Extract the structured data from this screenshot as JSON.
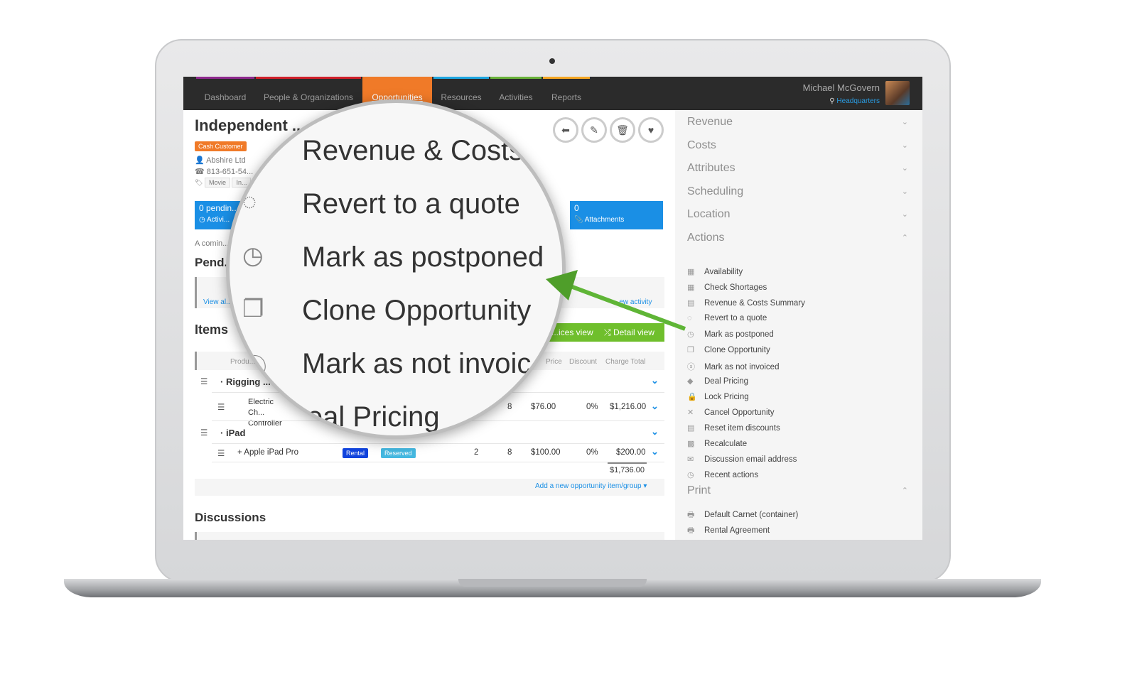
{
  "nav": {
    "items": [
      "Dashboard",
      "People & Organizations",
      "Opportunities",
      "Resources",
      "Activities",
      "Reports"
    ],
    "active": "Opportunities",
    "stripe_colors": [
      "#8e2a8e",
      "#d0202a",
      "#f07a28",
      "#1ea6e0",
      "#6ab23a",
      "#f5a623"
    ]
  },
  "user": {
    "name": "Michael McGovern",
    "store": "Headquarters"
  },
  "opportunity": {
    "title": "Independent ...",
    "customer_badge": "Cash Customer",
    "organization": "Abshire Ltd",
    "phone": "813-651-54...",
    "tags": [
      "Movie",
      "In..."
    ],
    "pending": "0 pendin...",
    "activities": "Activi...",
    "attachments_count": "0",
    "attachments": "Attachments",
    "coming": "A comin...",
    "pending_heading": "Pend...",
    "view_all": "View al...",
    "new_activity": "...ew activity"
  },
  "items": {
    "heading": "Items",
    "services_view": "...ices view",
    "detail_view": "Detail view",
    "columns": [
      "Produ...",
      "Price",
      "Discount",
      "Charge Total"
    ],
    "groups": [
      {
        "name": "Rigging ...",
        "rows": [
          {
            "name": "Electric Ch... Controller",
            "days": "8",
            "price": "$76.00",
            "discount": "0%",
            "total": "$1,216.00"
          }
        ]
      },
      {
        "name": "iPad",
        "rows": [
          {
            "name": "Apple iPad Pro",
            "type": "Rental",
            "status": "Reserved",
            "qty": "2",
            "days": "8",
            "price": "$100.00",
            "discount": "0%",
            "total": "$200.00"
          }
        ]
      }
    ],
    "grand_total": "$1,736.00",
    "add_link": "Add a new opportunity item/group"
  },
  "discussions": {
    "heading": "Discussions"
  },
  "sidebar": {
    "sections": [
      "Revenue",
      "Costs",
      "Attributes",
      "Scheduling",
      "Location",
      "Actions"
    ],
    "actions": [
      {
        "label": "Availability",
        "icon": "calendar-icon"
      },
      {
        "label": "Check Shortages",
        "icon": "calendar-icon"
      },
      {
        "label": "Revenue & Costs Summary",
        "icon": "money-icon"
      },
      {
        "label": "Revert to a quote",
        "icon": "refresh-icon"
      },
      {
        "label": "Mark as postponed",
        "icon": "clock-icon"
      },
      {
        "label": "Clone Opportunity",
        "icon": "copy-icon"
      },
      {
        "label": "Mark as not invoiced",
        "icon": "dollar-icon"
      },
      {
        "label": "Deal Pricing",
        "icon": "tag-icon"
      },
      {
        "label": "Lock Pricing",
        "icon": "lock-icon"
      },
      {
        "label": "Cancel Opportunity",
        "icon": "close-icon"
      },
      {
        "label": "Reset item discounts",
        "icon": "money-icon"
      },
      {
        "label": "Recalculate",
        "icon": "calculator-icon"
      },
      {
        "label": "Discussion email address",
        "icon": "envelope-icon"
      },
      {
        "label": "Recent actions",
        "icon": "clock-icon"
      }
    ],
    "print_heading": "Print",
    "print_items": [
      "Default Carnet (container)",
      "Rental Agreement"
    ]
  },
  "magnifier": {
    "items": [
      "Revenue & Costs",
      "Revert to a quote",
      "Mark as postponed",
      "Clone Opportunity",
      "Mark as not invoic",
      "Deal Pricing"
    ]
  },
  "colors": {
    "accent": "#f07a28",
    "blue": "#1a8fe5",
    "green": "#6fbf2c",
    "arrow": "#5fb536"
  }
}
